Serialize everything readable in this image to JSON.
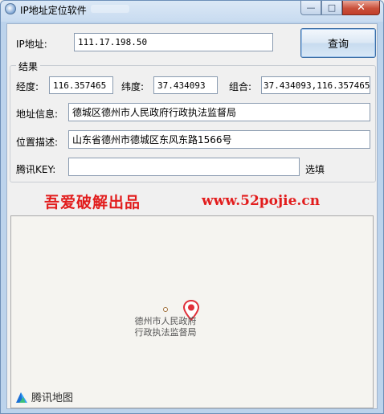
{
  "window": {
    "title": "IP地址定位软件"
  },
  "controls": {
    "min": "—",
    "max": "□",
    "close": "✕"
  },
  "query": {
    "ip_label": "IP地址:",
    "ip_value": "111.17.198.50",
    "button": "查询"
  },
  "results": {
    "group_title": "结果",
    "longitude_label": "经度:",
    "longitude_value": "116.357465",
    "latitude_label": "纬度:",
    "latitude_value": "37.434093",
    "combo_label": "组合:",
    "combo_value": "37.434093,116.357465",
    "address_label": "地址信息:",
    "address_value": "德城区德州市人民政府行政执法监督局",
    "position_label": "位置描述:",
    "position_value": "山东省德州市德城区东风东路1566号",
    "key_label": "腾讯KEY:",
    "key_value": "",
    "key_hint": "选填"
  },
  "promo": {
    "left": "吾爱破解出品",
    "right": "www.52pojie.cn"
  },
  "map": {
    "label_line1": "德州市人民政府",
    "label_line2": "行政执法监督局",
    "logo_text": "腾讯地图",
    "pin_color": "#e0303a"
  },
  "colors": {
    "accent_red": "#e21d1d"
  }
}
